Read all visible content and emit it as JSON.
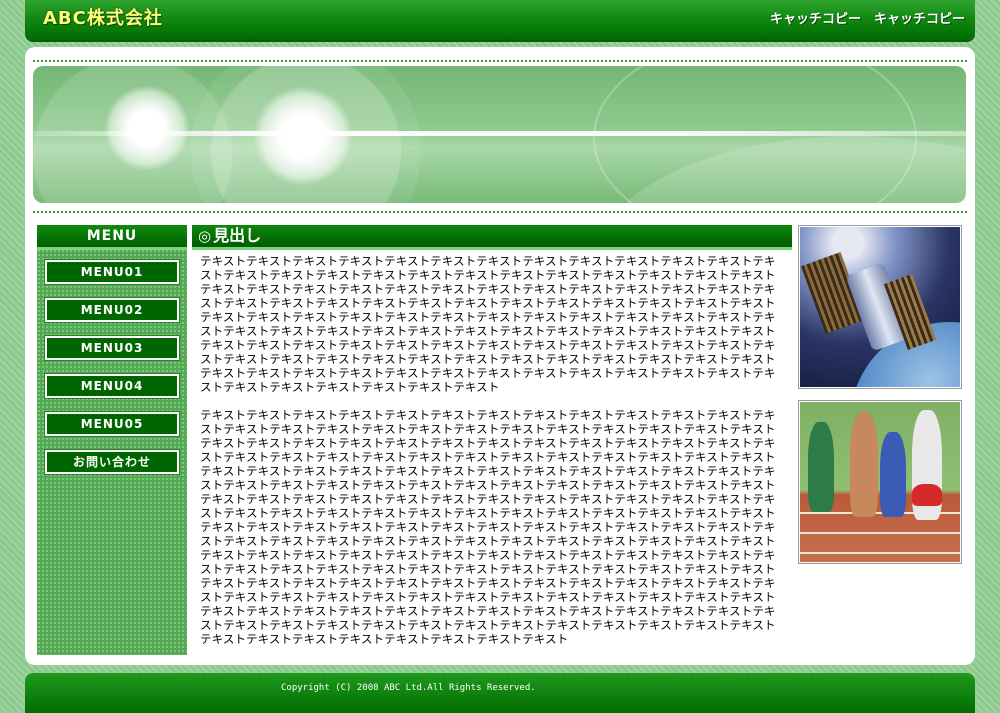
{
  "header": {
    "logo": "ABC株式会社",
    "catchcopy": "キャッチコピー　キャッチコピー"
  },
  "menu": {
    "title": "MENU",
    "items": [
      "MENU01",
      "MENU02",
      "MENU03",
      "MENU04",
      "MENU05",
      "お問い合わせ"
    ]
  },
  "content": {
    "heading_mark": "◎",
    "heading": "見出し",
    "paragraph1": "テキストテキストテキストテキストテキストテキストテキストテキストテキストテキストテキストテキストテキストテキストテキストテキストテキストテキストテキストテキストテキストテキストテキストテキストテキストテキストテキストテキストテキストテキストテキストテキストテキストテキストテキストテキストテキストテキストテキストテキストテキストテキストテキストテキストテキストテキストテキストテキストテキストテキストテキストテキストテキストテキストテキストテキストテキストテキストテキストテキストテキストテキストテキストテキストテキストテキストテキストテキストテキストテキストテキストテキストテキストテキストテキストテキストテキストテキストテキストテキストテキストテキストテキストテキストテキストテキストテキストテキストテキストテキストテキストテキストテキストテキストテキストテキストテキストテキストテキストテキストテキストテキストテキストテキストテキストテキストテキストテキストテキストテキストテキストテキストテキストテキストテキストテキストテキストテキストテキスト",
    "paragraph2": "テキストテキストテキストテキストテキストテキストテキストテキストテキストテキストテキストテキストテキストテキストテキストテキストテキストテキストテキストテキストテキストテキストテキストテキストテキストテキストテキストテキストテキストテキストテキストテキストテキストテキストテキストテキストテキストテキストテキストテキストテキストテキストテキストテキストテキストテキストテキストテキストテキストテキストテキストテキストテキストテキストテキストテキストテキストテキストテキストテキストテキストテキストテキストテキストテキストテキストテキストテキストテキストテキストテキストテキストテキストテキストテキストテキストテキストテキストテキストテキストテキストテキストテキストテキストテキストテキストテキストテキストテキストテキストテキストテキストテキストテキストテキストテキストテキストテキストテキストテキストテキストテキストテキストテキストテキストテキストテキストテキストテキストテキストテキストテキストテキストテキストテキストテキストテキストテキストテキストテキストテキストテキストテキストテキストテキストテキストテキストテキストテキストテキストテキストテキストテキストテキストテキストテキストテキストテキストテキストテキストテキストテキストテキストテキストテキストテキストテキストテキストテキストテキストテキストテキストテキストテキストテキストテキストテキストテキストテキストテキストテキストテキストテキストテキストテキストテキストテキストテキストテキストテキストテキストテキストテキストテキストテキストテキストテキストテキストテキストテキストテキストテキストテキストテキストテキストテキストテキストテキストテキストテキストテキストテキストテキストテキストテキストテキストテキストテキストテキストテキストテキストテキストテキストテキストテキストテキストテキストテキスト"
  },
  "footer": {
    "copyright": "Copyright (C) 2008 ABC Ltd.All Rights Reserved."
  },
  "colors": {
    "accent": "#006600",
    "page_bg": "#8cc98c",
    "highlight": "#7fd27f",
    "logo_text": "#ffff77"
  },
  "icons": {
    "heading_mark": "double-circle-icon"
  }
}
